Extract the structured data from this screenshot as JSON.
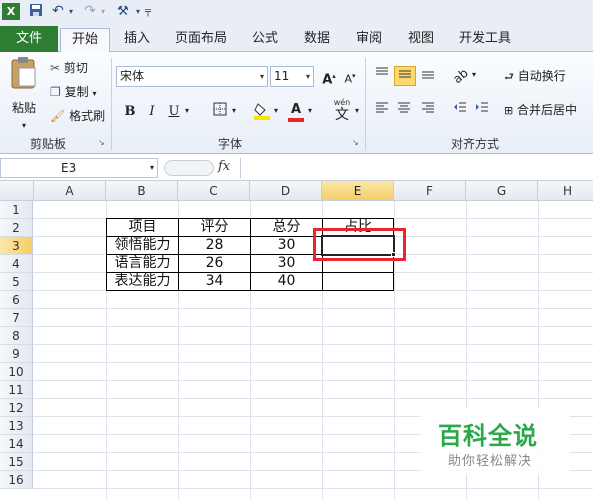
{
  "quick_access": {
    "save_icon": "save-icon",
    "undo_icon": "undo-icon",
    "redo_icon": "redo-icon"
  },
  "tabs": [
    {
      "label": "文件"
    },
    {
      "label": "开始"
    },
    {
      "label": "插入"
    },
    {
      "label": "页面布局"
    },
    {
      "label": "公式"
    },
    {
      "label": "数据"
    },
    {
      "label": "审阅"
    },
    {
      "label": "视图"
    },
    {
      "label": "开发工具"
    }
  ],
  "ribbon": {
    "clipboard": {
      "paste": "粘贴",
      "cut": "剪切",
      "copy": "复制",
      "format_painter": "格式刷",
      "group": "剪贴板"
    },
    "font": {
      "name": "宋体",
      "size": "11",
      "bold": "B",
      "italic": "I",
      "underline": "U",
      "grow": "A",
      "shrink": "A",
      "wen": "wén",
      "wen_char": "文",
      "group": "字体",
      "font_color": "#e8262b",
      "fill_color": "#ffe400"
    },
    "alignment": {
      "wrap": "自动换行",
      "merge": "合并后居中",
      "group": "对齐方式"
    }
  },
  "formula_bar": {
    "name_box": "E3",
    "fx": "fx",
    "formula": ""
  },
  "columns": [
    "A",
    "B",
    "C",
    "D",
    "E",
    "F",
    "G",
    "H"
  ],
  "rows": [
    "1",
    "2",
    "3",
    "4",
    "5",
    "6",
    "7",
    "8",
    "9",
    "10",
    "11",
    "12",
    "13",
    "14",
    "15",
    "16"
  ],
  "table": {
    "headers": [
      "项目",
      "评分",
      "总分",
      "占比"
    ],
    "rows": [
      [
        "领悟能力",
        "28",
        "30",
        ""
      ],
      [
        "语言能力",
        "26",
        "30",
        ""
      ],
      [
        "表达能力",
        "34",
        "40",
        ""
      ]
    ]
  },
  "watermark": {
    "title": "百科全说",
    "subtitle": "助你轻松解决"
  }
}
